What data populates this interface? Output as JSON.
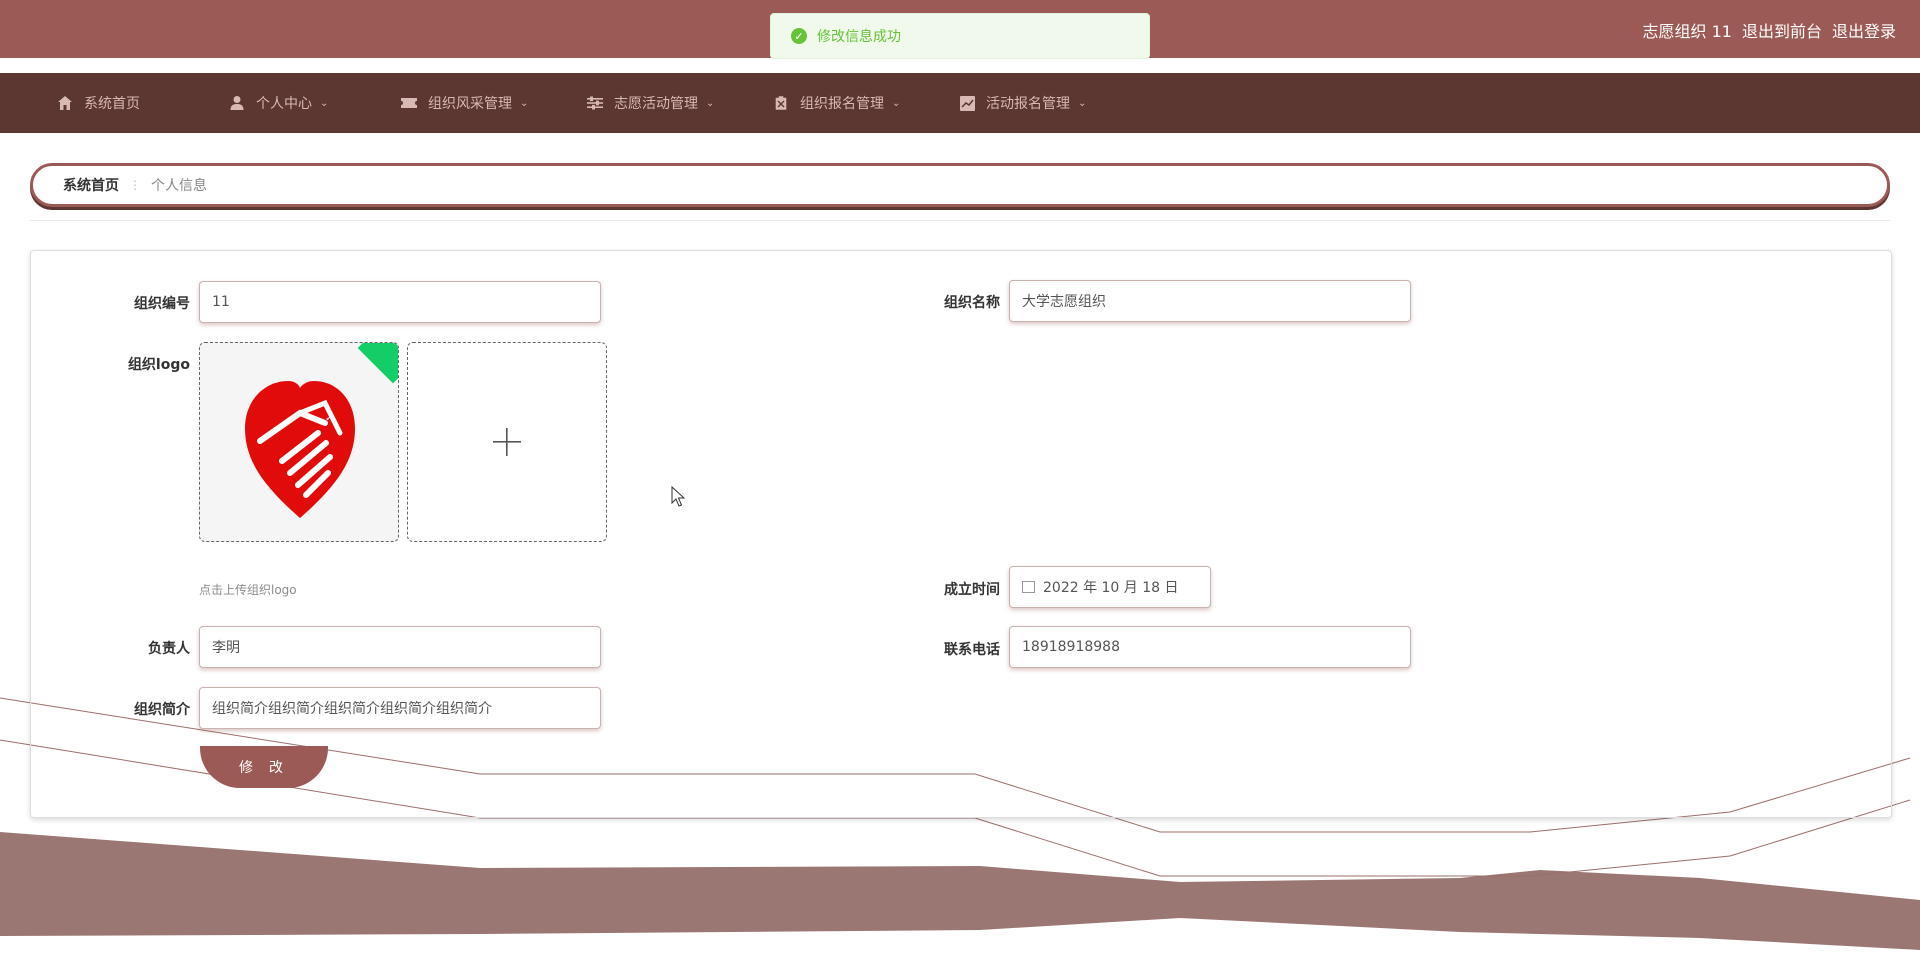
{
  "header": {
    "user": "志愿组织 11",
    "to_front": "退出到前台",
    "logout": "退出登录",
    "bg_color": "#9b5a56"
  },
  "toast": {
    "message": "修改信息成功",
    "icon": "check-circle-icon"
  },
  "nav": {
    "bg_color": "#5c3631",
    "items": [
      {
        "label": "系统首页",
        "icon": "home-icon"
      },
      {
        "label": "个人中心",
        "icon": "user-icon"
      },
      {
        "label": "组织风采管理",
        "icon": "ticket-icon"
      },
      {
        "label": "志愿活动管理",
        "icon": "sliders-icon"
      },
      {
        "label": "组织报名管理",
        "icon": "clipboard-icon"
      },
      {
        "label": "活动报名管理",
        "icon": "chart-icon"
      }
    ]
  },
  "breadcrumb": {
    "home": "系统首页",
    "current": "个人信息"
  },
  "form": {
    "org_no_label": "组织编号",
    "org_no_value": "11",
    "org_name_label": "组织名称",
    "org_name_value": "大学志愿组织",
    "logo_label": "组织logo",
    "logo_hint": "点击上传组织logo",
    "founded_label": "成立时间",
    "founded_value": "2022 年 10 月 18 日",
    "leader_label": "负责人",
    "leader_value": "李明",
    "phone_label": "联系电话",
    "phone_value": "18918918988",
    "intro_label": "组织简介",
    "intro_value": "组织简介组织简介组织简介组织简介组织简介",
    "submit_label": "修 改"
  }
}
